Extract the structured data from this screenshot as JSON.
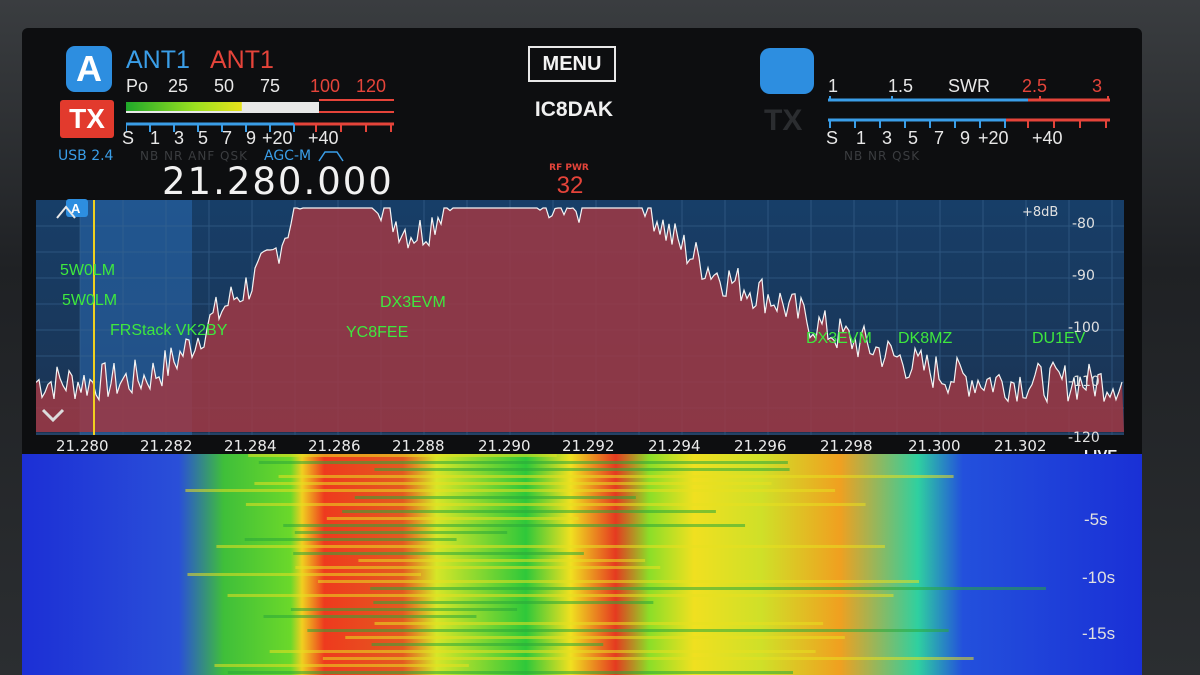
{
  "antenna": {
    "badge": "A",
    "ant1_main": "ANT1",
    "ant1_sub": "ANT1"
  },
  "tx_badge": "TX",
  "po_meter": {
    "label": "Po",
    "ticks": [
      "25",
      "50",
      "75"
    ],
    "red_ticks": [
      "100",
      "120"
    ],
    "level_fraction": 0.6
  },
  "s_meter": {
    "ticks": [
      "S",
      "1",
      "3",
      "5",
      "7",
      "9",
      "+20",
      "+40"
    ]
  },
  "mode": "USB  2.4",
  "agc": "AGC-M",
  "ghost_functions": "NB NR ANF QSK",
  "frequency": "21.280.000",
  "menu_label": "MENU",
  "callsign": "IC8DAK",
  "rf_power": {
    "label": "RF PWR",
    "value": "32"
  },
  "sub_panel": {
    "tx": "TX",
    "swr_ticks": [
      "1",
      "1.5",
      "SWR"
    ],
    "swr_red_ticks": [
      "2.5",
      "3"
    ],
    "s_ticks": [
      "S",
      "1",
      "3",
      "5",
      "7",
      "9",
      "+20",
      "+40"
    ],
    "ghost_functions": "NB NR   QSK"
  },
  "spectrum": {
    "db_offset": "+8dB",
    "db_labels": [
      "-80",
      "-90",
      "-100",
      "-110",
      "-120"
    ],
    "freq_labels": [
      "21.280",
      "21.282",
      "21.284",
      "21.286",
      "21.288",
      "21.290",
      "21.292",
      "21.294",
      "21.296",
      "21.298",
      "21.300",
      "21.302"
    ],
    "live_label": "LIVE",
    "spots": [
      "5W0LM",
      "5W0LM",
      "FRStack VK2BY",
      "DX3EVM",
      "YC8FEE",
      "DX3EVM",
      "DK8MZ",
      "DU1EV"
    ]
  },
  "waterfall": {
    "time_labels": [
      "-5s",
      "-10s",
      "-15s"
    ]
  },
  "colors": {
    "accent_blue": "#2d8ee0",
    "tx_red": "#e23a2d",
    "spot_green": "#3ee83e",
    "signal_fill": "#a03844"
  }
}
